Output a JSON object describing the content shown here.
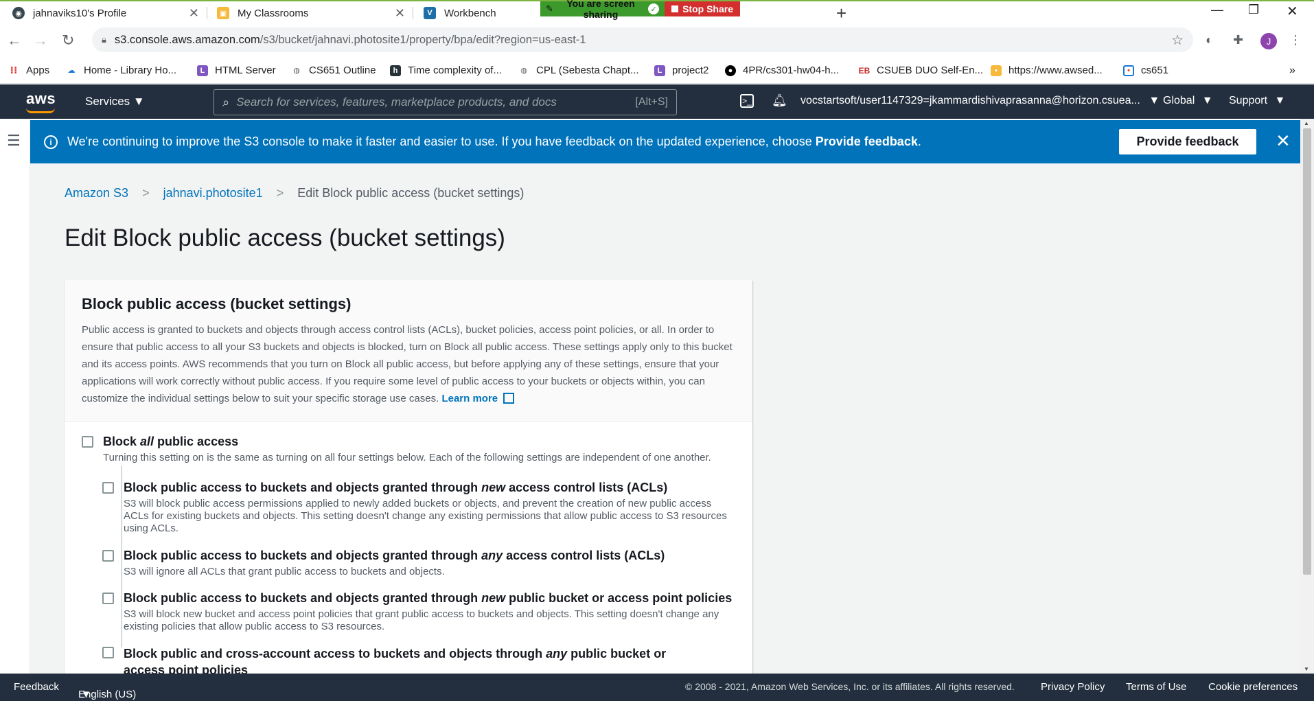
{
  "browser": {
    "tabs": [
      {
        "title": "jahnaviks10's Profile"
      },
      {
        "title": "My Classrooms"
      },
      {
        "title": "Workbench"
      }
    ],
    "screen_share": {
      "message": "You are screen sharing",
      "stop_label": "Stop Share"
    },
    "url": {
      "host": "s3.console.aws.amazon.com",
      "path": "/s3/bucket/jahnavi.photosite1/property/bpa/edit?region=us-east-1"
    },
    "profile_initial": "J"
  },
  "bookmarks": [
    {
      "label": "Apps",
      "icon": "apps-grid-icon"
    },
    {
      "label": "Home - Library Ho...",
      "icon": "library-icon"
    },
    {
      "label": "HTML Server",
      "icon": "lc-icon"
    },
    {
      "label": "CS651 Outline",
      "icon": "globe-icon"
    },
    {
      "label": "Time complexity of...",
      "icon": "h-icon"
    },
    {
      "label": "CPL (Sebesta Chapt...",
      "icon": "globe-icon"
    },
    {
      "label": "project2",
      "icon": "lc-icon"
    },
    {
      "label": "4PR/cs301-hw04-h...",
      "icon": "github-icon"
    },
    {
      "label": "CSUEB DUO Self-En...",
      "icon": "eb-icon"
    },
    {
      "label": "https://www.awsed...",
      "icon": "box-icon"
    },
    {
      "label": "cs651",
      "icon": "calendar-icon"
    }
  ],
  "aws_nav": {
    "logo": "aws",
    "services_label": "Services",
    "search_placeholder": "Search for services, features, marketplace products, and docs",
    "search_shortcut": "[Alt+S]",
    "account": "vocstartsoft/user1147329=jkammardishivaprasanna@horizon.csuea...",
    "region": "Global",
    "support": "Support"
  },
  "banner": {
    "text_before": "We're continuing to improve the S3 console to make it faster and easier to use. If you have feedback on the updated experience, choose ",
    "text_bold": "Provide feedback",
    "text_after": ".",
    "button_label": "Provide feedback"
  },
  "breadcrumb": {
    "root": "Amazon S3",
    "bucket": "jahnavi.photosite1",
    "current": "Edit Block public access (bucket settings)"
  },
  "page_title": "Edit Block public access (bucket settings)",
  "panel": {
    "title": "Block public access (bucket settings)",
    "description": "Public access is granted to buckets and objects through access control lists (ACLs), bucket policies, access point policies, or all. In order to ensure that public access to all your S3 buckets and objects is blocked, turn on Block all public access. These settings apply only to this bucket and its access points. AWS recommends that you turn on Block all public access, but before applying any of these settings, ensure that your applications will work correctly without public access. If you require some level of public access to your buckets or objects within, you can customize the individual settings below to suit your specific storage use cases.",
    "learn_more": "Learn more"
  },
  "block_all": {
    "pre": "Block ",
    "em": "all",
    "post": " public access",
    "description": "Turning this setting on is the same as turning on all four settings below. Each of the following settings are independent of one another.",
    "checked": false
  },
  "options": [
    {
      "pre": "Block public access to buckets and objects granted through ",
      "em": "new",
      "post": " access control lists (ACLs)",
      "description": "S3 will block public access permissions applied to newly added buckets or objects, and prevent the creation of new public access ACLs for existing buckets and objects. This setting doesn't change any existing permissions that allow public access to S3 resources using ACLs.",
      "checked": false
    },
    {
      "pre": "Block public access to buckets and objects granted through ",
      "em": "any",
      "post": " access control lists (ACLs)",
      "description": "S3 will ignore all ACLs that grant public access to buckets and objects.",
      "checked": false
    },
    {
      "pre": "Block public access to buckets and objects granted through ",
      "em": "new",
      "post": " public bucket or access point policies",
      "description": "S3 will block new bucket and access point policies that grant public access to buckets and objects. This setting doesn't change any existing policies that allow public access to S3 resources.",
      "checked": false
    },
    {
      "pre": "Block public and cross-account access to buckets and objects through ",
      "em": "any",
      "post": " public bucket or access point policies",
      "description": "",
      "checked": false
    }
  ],
  "footer": {
    "feedback": "Feedback",
    "language": "English (US)",
    "copyright": "© 2008 - 2021, Amazon Web Services, Inc. or its affiliates. All rights reserved.",
    "privacy": "Privacy Policy",
    "terms": "Terms of Use",
    "cookies": "Cookie preferences"
  },
  "colors": {
    "aws_nav": "#232f3e",
    "banner": "#0073bb",
    "link": "#0073bb",
    "aws_orange": "#ff9900"
  }
}
